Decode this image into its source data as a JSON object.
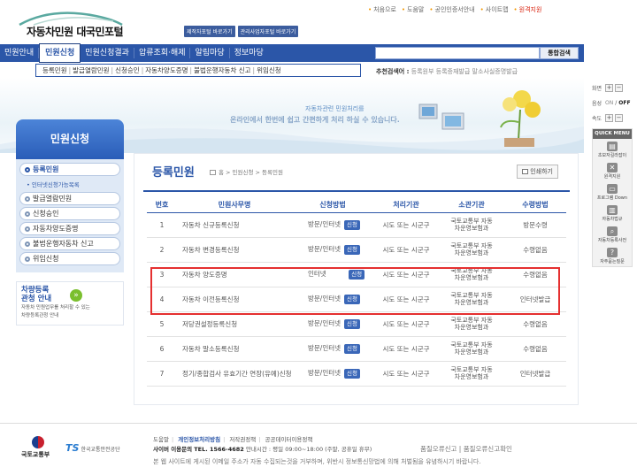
{
  "utility_links": [
    "처음으로",
    "도움말",
    "공인인증서안내",
    "사이트맵",
    "원격지원"
  ],
  "logo_text": "자동차민원 대국민포털",
  "top_links": [
    "제작자포털 바로가기",
    "관리사업자포털 바로가기"
  ],
  "gnb": {
    "menu": [
      "민원안내",
      "민원신청",
      "민원신청결과",
      "압류조회·해제",
      "알림마당",
      "정보마당"
    ],
    "active_index": 1,
    "search_button": "통합검색"
  },
  "subnav": [
    "등록민원",
    "발급열람민원",
    "신청승인",
    "자동차양도증명",
    "불법운행자동차 신고",
    "위임신청"
  ],
  "recommend": {
    "label": "추천검색어 :",
    "terms": "등록원부  등록증재발급  말소사실증명발급"
  },
  "banner": {
    "title": "자동차관련 민원처리를",
    "message": "온라인에서 한번에 쉽고 간편하게 처리 하실 수 있습니다."
  },
  "lnb": {
    "title": "민원신청",
    "items": [
      {
        "label": "등록민원"
      },
      {
        "label": "발급열람민원"
      },
      {
        "label": "신청승인"
      },
      {
        "label": "자동차양도증명"
      },
      {
        "label": "불법운행자동차 신고"
      },
      {
        "label": "위임신청"
      }
    ],
    "sub_item": "인터넷신청가능목록",
    "banner_line1": "차량등록",
    "banner_line2": "관청 안내",
    "banner_desc1": "자동차 민원업무를 처리할 수 있는",
    "banner_desc2": "차량등록관청 안내"
  },
  "content": {
    "title": "등록민원",
    "breadcrumb": "홈 > 민원신청 > 등록민원",
    "print_label": "인쇄하기",
    "headers": [
      "번호",
      "민원사무명",
      "신청방법",
      "처리기관",
      "소관기관",
      "수령방법"
    ],
    "apply_label": "신청",
    "rows": [
      {
        "no": "1",
        "name": "자동차 신규등록신청",
        "method": "방문/인터넷",
        "proc": "시도 또는 시군구",
        "agency1": "국토교통부 자동",
        "agency2": "차운영보험과",
        "receive": "방문수령"
      },
      {
        "no": "2",
        "name": "자동차 변경등록신청",
        "method": "방문/인터넷",
        "proc": "시도 또는 시군구",
        "agency1": "국토교통부 자동",
        "agency2": "차운영보험과",
        "receive": "수령없음"
      },
      {
        "no": "3",
        "name": "자동차 양도증명",
        "method": "인터넷",
        "proc": "시도 또는 시군구",
        "agency1": "국토교통부 자동",
        "agency2": "차운영보험과",
        "receive": "수령없음"
      },
      {
        "no": "4",
        "name": "자동차 이전등록신청",
        "method": "방문/인터넷",
        "proc": "시도 또는 시군구",
        "agency1": "국토교통부 자동",
        "agency2": "차운영보험과",
        "receive": "인터넷발급"
      },
      {
        "no": "5",
        "name": "저당권설정등록신청",
        "method": "방문/인터넷",
        "proc": "시도 또는 시군구",
        "agency1": "국토교통부 자동",
        "agency2": "차운영보험과",
        "receive": "수령없음"
      },
      {
        "no": "6",
        "name": "자동차 말소등록신청",
        "method": "방문/인터넷",
        "proc": "시도 또는 시군구",
        "agency1": "국토교통부 자동",
        "agency2": "차운영보험과",
        "receive": "수령없음"
      },
      {
        "no": "7",
        "name": "정기/종합검사 유효기간 연장(유예)신청",
        "method": "방문/인터넷",
        "proc": "시도 또는 시군구",
        "agency1": "국토교통부 자동",
        "agency2": "차운영보험과",
        "receive": "인터넷발급"
      }
    ]
  },
  "sidebar": {
    "zoom_label": "화면",
    "sound_label": "음성",
    "sound_on": "ON",
    "sound_off": "OFF",
    "speed_label": "속도",
    "quick_title": "QUICK MENU",
    "quick_items": [
      "초보자길라잡이",
      "원격지원",
      "프로그램 Down",
      "자동차법규",
      "자동차등록사전",
      "자주묻는질문"
    ]
  },
  "footer": {
    "logo1": "국토교통부",
    "logo2_mark": "TS",
    "logo2_text": "한국교통안전공단",
    "links": [
      "도움말",
      "개인정보처리방침",
      "저작권정책",
      "공공데이터이용정책"
    ],
    "contact_label": "사이버 이용문의",
    "contact_tel": "TEL. 1566-4682",
    "contact_hours": "안내시간 : 평일 09:00~18:00 (주말, 공휴일 휴무)",
    "report": "품질오류신고 | 품질오류신고확인",
    "notice": "본 웹 사이트에 게시된 이메일 주소가 자동 수집되는것을 거부하며, 위반시 정보통신망법에 의해 처벌됨을 유념하시기 바랍니다."
  },
  "colors": {
    "primary": "#2b56a8",
    "highlight": "#e53030",
    "accent": "#f39800"
  }
}
